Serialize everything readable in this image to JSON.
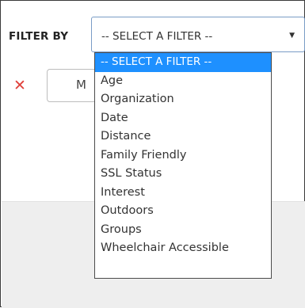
{
  "filter": {
    "label": "FILTER BY",
    "selected_value": "-- SELECT A FILTER --",
    "options": [
      "-- SELECT A FILTER --",
      "Age",
      "Organization",
      "Date",
      "Distance",
      "Family Friendly",
      "SSL Status",
      "Interest",
      "Outdoors",
      "Groups",
      "Wheelchair Accessible"
    ],
    "highlighted_index": 0
  },
  "row": {
    "remove_icon": "close-icon",
    "partial_field_text": "M"
  },
  "colors": {
    "highlight": "#1e90ff",
    "remove_icon": "#e0413b",
    "select_border": "#7a9cc6"
  }
}
